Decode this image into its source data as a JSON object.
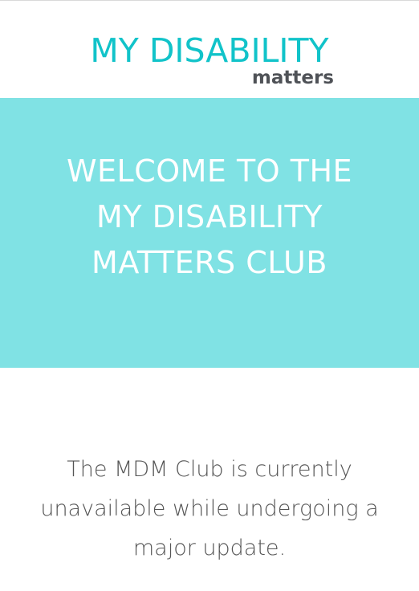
{
  "logo": {
    "line1": "MY DISABILITY",
    "line2": "matters",
    "colors": {
      "primary": "#11c3c9",
      "secondary": "#4f5257"
    }
  },
  "hero": {
    "line1": "WELCOME TO THE",
    "line2": "MY DISABILITY",
    "line3": "MATTERS CLUB",
    "background": "#80e2e4"
  },
  "notice": {
    "line1": "The MDM Club is currently",
    "line2": "unavailable while undergoing a",
    "line3": "major update."
  }
}
